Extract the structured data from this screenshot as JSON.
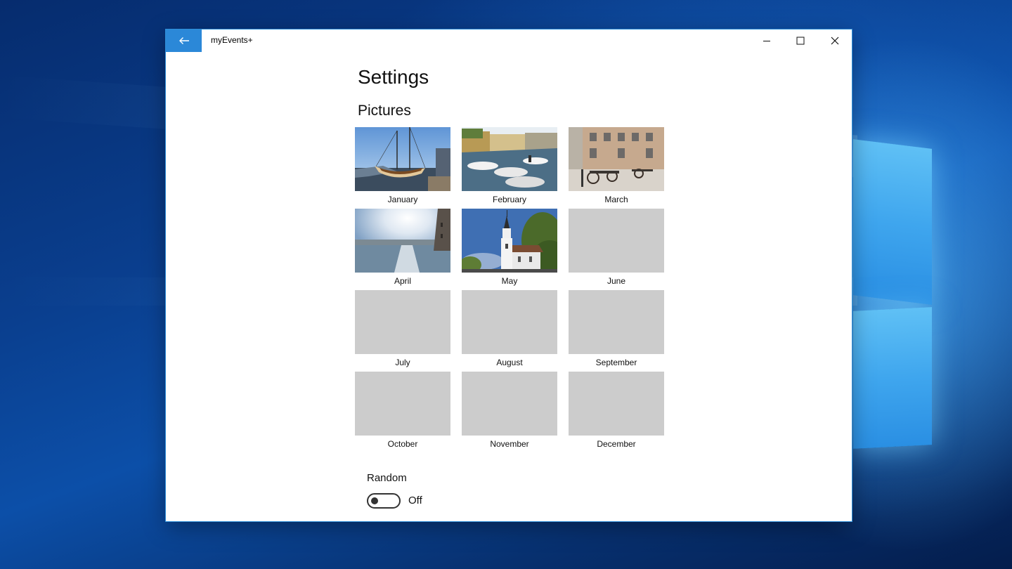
{
  "window": {
    "app_title": "myEvents+",
    "accent_color": "#2b88d8"
  },
  "page": {
    "title": "Settings",
    "pictures_header": "Pictures"
  },
  "months": [
    {
      "label": "January",
      "has_image": true,
      "image": "ship-at-harbor"
    },
    {
      "label": "February",
      "has_image": true,
      "image": "boats-in-canal"
    },
    {
      "label": "March",
      "has_image": true,
      "image": "cannons-in-square"
    },
    {
      "label": "April",
      "has_image": true,
      "image": "sunlit-waterfront"
    },
    {
      "label": "May",
      "has_image": true,
      "image": "white-church"
    },
    {
      "label": "June",
      "has_image": false
    },
    {
      "label": "July",
      "has_image": false
    },
    {
      "label": "August",
      "has_image": false
    },
    {
      "label": "September",
      "has_image": false
    },
    {
      "label": "October",
      "has_image": false
    },
    {
      "label": "November",
      "has_image": false
    },
    {
      "label": "December",
      "has_image": false
    }
  ],
  "random": {
    "header": "Random",
    "state_label": "Off",
    "is_on": false
  },
  "icons": {
    "back": "arrow-left-icon",
    "minimize": "minimize-icon",
    "maximize": "maximize-icon",
    "close": "close-icon"
  },
  "colors": {
    "placeholder": "#cccccc",
    "desktop_blue": "#0a3f8f"
  }
}
